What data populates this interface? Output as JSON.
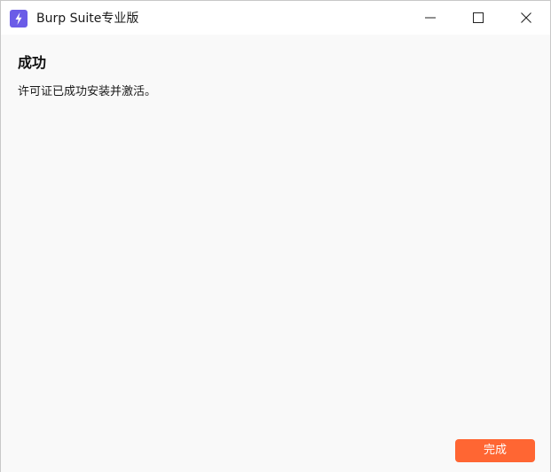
{
  "window": {
    "title": "Burp Suite专业版",
    "app_icon": "lightning-bolt-icon",
    "controls": {
      "minimize_icon": "minimize-icon",
      "maximize_icon": "maximize-icon",
      "close_icon": "close-icon"
    }
  },
  "content": {
    "heading": "成功",
    "message": "许可证已成功安装并激活。"
  },
  "footer": {
    "finish_label": "完成"
  },
  "colors": {
    "accent": "#ff6633",
    "app_icon_bg": "#6b5ce7",
    "background": "#f9f9f9",
    "titlebar": "#ffffff"
  }
}
